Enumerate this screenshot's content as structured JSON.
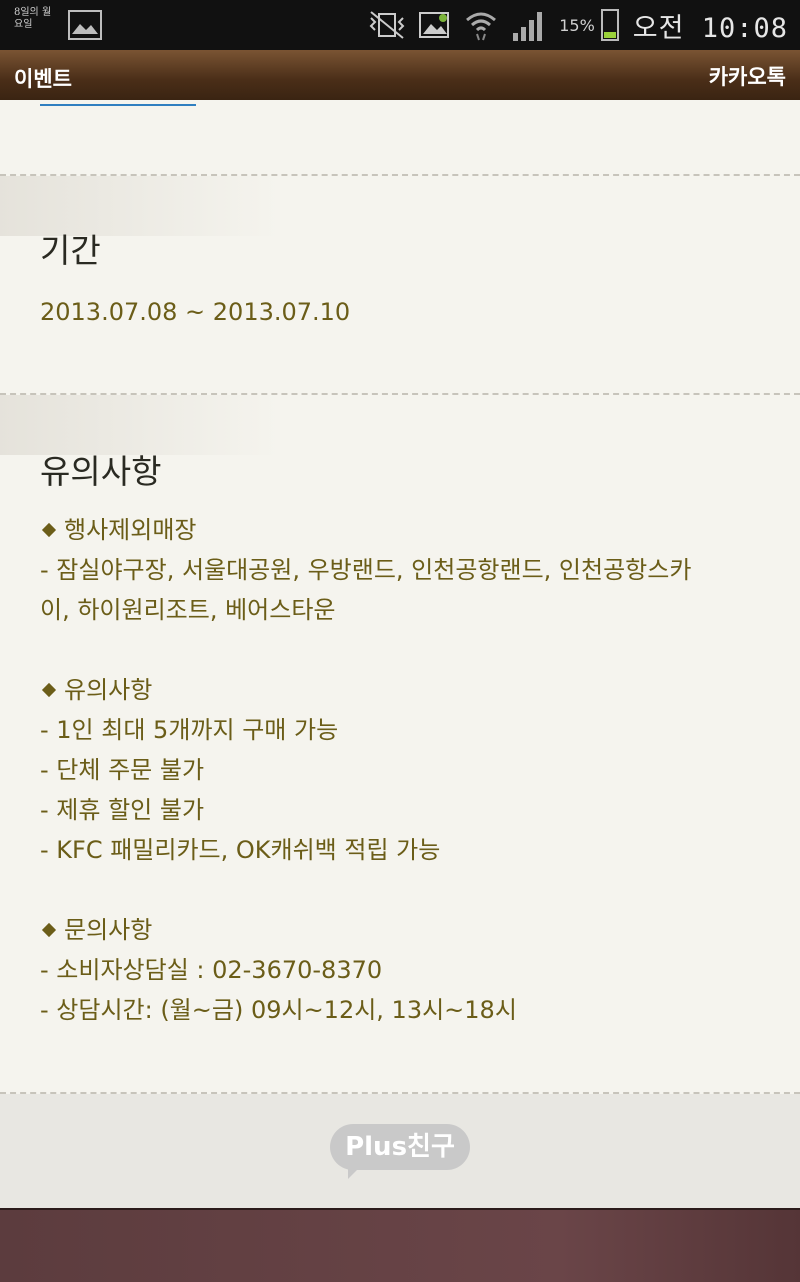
{
  "status_bar": {
    "notification_text": "8일의 월요일",
    "battery_percent": "15%",
    "time": "오전 10:08"
  },
  "title_bar": {
    "left": "이벤트",
    "right": "카카오톡"
  },
  "period": {
    "heading": "기간",
    "value": "2013.07.08 ~ 2013.07.10"
  },
  "notes": {
    "heading": "유의사항",
    "sections": [
      {
        "title": "행사제외매장",
        "lines": [
          "- 잠실야구장, 서울대공원, 우방랜드, 인천공항랜드, 인천공항스카",
          "이, 하이원리조트, 베어스타운"
        ]
      },
      {
        "title": "유의사항",
        "lines": [
          "- 1인 최대 5개까지 구매 가능",
          "- 단체 주문 불가",
          "- 제휴 할인 불가",
          "- KFC 패밀리카드, OK캐쉬백 적립 가능"
        ]
      },
      {
        "title": "문의사항",
        "lines": [
          "- 소비자상담실 : 02-3670-8370",
          "- 상담시간: (월~금) 09시~12시, 13시~18시"
        ]
      }
    ]
  },
  "footer": {
    "plus_button": "Plus친구"
  }
}
